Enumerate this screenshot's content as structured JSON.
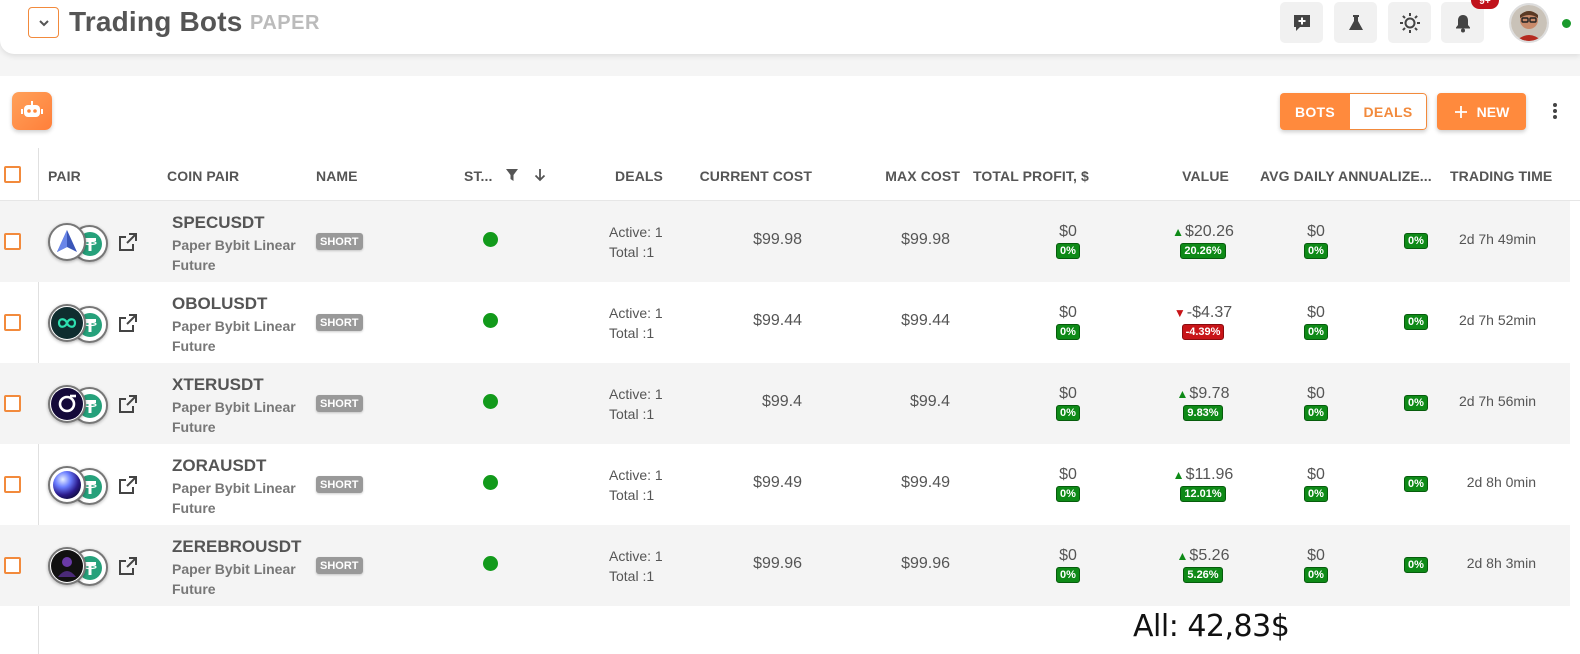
{
  "header": {
    "title": "Trading Bots",
    "mode": "PAPER",
    "notification_count": "9+"
  },
  "toolbar": {
    "bots_label": "BOTS",
    "deals_label": "DEALS",
    "new_label": "NEW"
  },
  "table": {
    "columns": {
      "pair": "PAIR",
      "coin_pair": "COIN PAIR",
      "name": "NAME",
      "status": "ST...",
      "deals": "DEALS",
      "current_cost": "CURRENT COST",
      "max_cost": "MAX COST",
      "total_profit": "TOTAL PROFIT, $",
      "value": "VALUE",
      "avg_daily": "AVG DAILY",
      "annualized": "ANNUALIZE...",
      "trading_time": "TRADING TIME"
    },
    "rows": [
      {
        "symbol": "SPECUSDT",
        "exchange": "Paper Bybit Linear Future",
        "name_tag": "SHORT",
        "deals_active": "Active: 1",
        "deals_total": "Total :1",
        "current_cost": "$99.98",
        "max_cost": "$99.98",
        "total_profit": "$0",
        "total_profit_pct": "0%",
        "value": "$20.26",
        "value_pct": "20.26%",
        "value_dir": "up",
        "avg_daily": "$0",
        "avg_daily_pct": "0%",
        "annualized_pct": "0%",
        "trading_time": "2d 7h 49min"
      },
      {
        "symbol": "OBOLUSDT",
        "exchange": "Paper Bybit Linear Future",
        "name_tag": "SHORT",
        "deals_active": "Active: 1",
        "deals_total": "Total :1",
        "current_cost": "$99.44",
        "max_cost": "$99.44",
        "total_profit": "$0",
        "total_profit_pct": "0%",
        "value": "-$4.37",
        "value_pct": "-4.39%",
        "value_dir": "down",
        "avg_daily": "$0",
        "avg_daily_pct": "0%",
        "annualized_pct": "0%",
        "trading_time": "2d 7h 52min"
      },
      {
        "symbol": "XTERUSDT",
        "exchange": "Paper Bybit Linear Future",
        "name_tag": "SHORT",
        "deals_active": "Active: 1",
        "deals_total": "Total :1",
        "current_cost": "$99.4",
        "max_cost": "$99.4",
        "total_profit": "$0",
        "total_profit_pct": "0%",
        "value": "$9.78",
        "value_pct": "9.83%",
        "value_dir": "up",
        "avg_daily": "$0",
        "avg_daily_pct": "0%",
        "annualized_pct": "0%",
        "trading_time": "2d 7h 56min"
      },
      {
        "symbol": "ZORAUSDT",
        "exchange": "Paper Bybit Linear Future",
        "name_tag": "SHORT",
        "deals_active": "Active: 1",
        "deals_total": "Total :1",
        "current_cost": "$99.49",
        "max_cost": "$99.49",
        "total_profit": "$0",
        "total_profit_pct": "0%",
        "value": "$11.96",
        "value_pct": "12.01%",
        "value_dir": "up",
        "avg_daily": "$0",
        "avg_daily_pct": "0%",
        "annualized_pct": "0%",
        "trading_time": "2d 8h 0min"
      },
      {
        "symbol": "ZEREBROUSDT",
        "exchange": "Paper Bybit Linear Future",
        "name_tag": "SHORT",
        "deals_active": "Active: 1",
        "deals_total": "Total :1",
        "current_cost": "$99.96",
        "max_cost": "$99.96",
        "total_profit": "$0",
        "total_profit_pct": "0%",
        "value": "$5.26",
        "value_pct": "5.26%",
        "value_dir": "up",
        "avg_daily": "$0",
        "avg_daily_pct": "0%",
        "annualized_pct": "0%",
        "trading_time": "2d 8h 3min"
      }
    ]
  },
  "footer": {
    "all_label": "All: 42,83$"
  },
  "colors": {
    "accent": "#ff8a3d",
    "positive": "#0e8a17",
    "negative": "#c81418",
    "status_active": "#129a1b"
  }
}
